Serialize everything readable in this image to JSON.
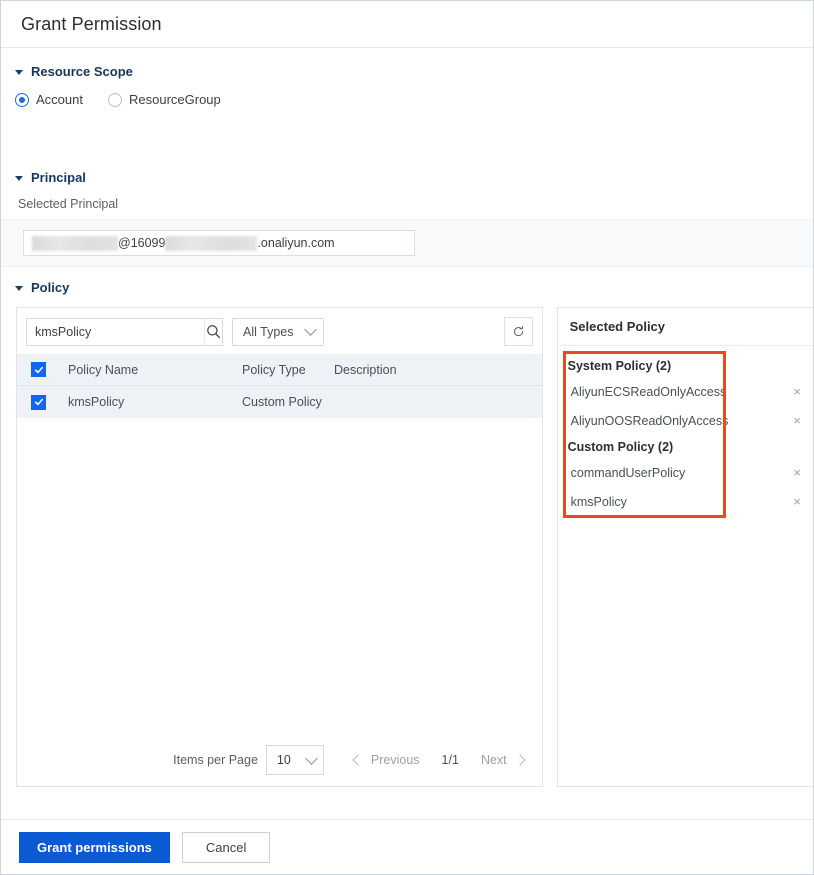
{
  "window": {
    "title": "Grant Permission"
  },
  "resource_scope": {
    "heading": "Resource Scope",
    "options": [
      {
        "label": "Account",
        "checked": true
      },
      {
        "label": "ResourceGroup",
        "checked": false
      }
    ]
  },
  "principal": {
    "heading": "Principal",
    "sub_label": "Selected Principal",
    "value_parts": {
      "middle": "@16099",
      "suffix": ".onaliyun.com"
    }
  },
  "policy": {
    "heading": "Policy",
    "search": {
      "value": "kmsPolicy",
      "placeholder": "",
      "search_icon": "search-icon"
    },
    "type_filter": {
      "selected": "All Types",
      "chevron": "chevron-down-icon"
    },
    "refresh_icon": "refresh-icon",
    "table": {
      "columns": [
        "Policy Name",
        "Policy Type",
        "Description"
      ],
      "header_checkbox_checked": true,
      "rows": [
        {
          "checked": true,
          "name": "kmsPolicy",
          "type": "Custom Policy",
          "description": ""
        }
      ]
    },
    "pagination": {
      "items_per_page_label": "Items per Page",
      "items_per_page_value": "10",
      "previous_label": "Previous",
      "page_indicator": "1/1",
      "next_label": "Next"
    }
  },
  "selected_policy": {
    "heading": "Selected Policy",
    "groups": [
      {
        "title": "System Policy (2)",
        "items": [
          "AliyunECSReadOnlyAccess",
          "AliyunOOSReadOnlyAccess"
        ]
      },
      {
        "title": "Custom Policy (2)",
        "items": [
          "commandUserPolicy",
          "kmsPolicy"
        ]
      }
    ],
    "remove_label": "×",
    "highlight_color": "#e8491f"
  },
  "footer": {
    "primary_label": "Grant permissions",
    "cancel_label": "Cancel"
  },
  "colors": {
    "accent": "#0a5bd3",
    "checkbox": "#1366ec",
    "heading": "#16365c",
    "highlight": "#e8491f",
    "row_bg": "#eef1f5"
  }
}
